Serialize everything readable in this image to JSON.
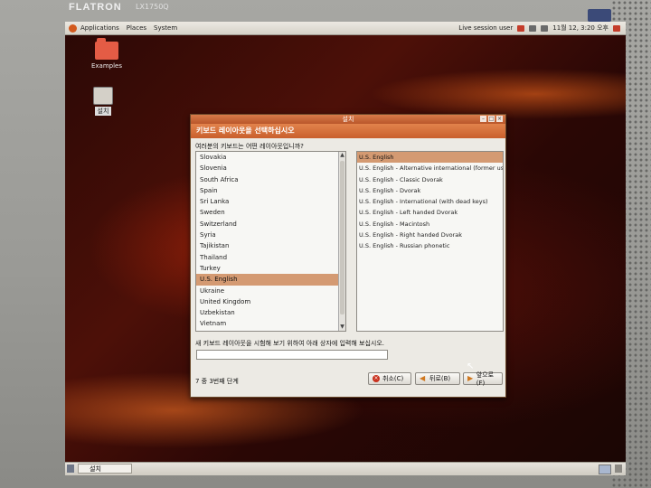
{
  "monitor": {
    "brand": "FLATRON",
    "model": "LX1750Q"
  },
  "top_panel": {
    "menus": [
      "Applications",
      "Places",
      "System"
    ],
    "session": "Live session user",
    "clock": "11월 12, 3:20 오후"
  },
  "desktop": {
    "icons": [
      {
        "label": "Examples"
      },
      {
        "label": "설치"
      }
    ]
  },
  "dialog": {
    "title": "설치",
    "header": "키보드 레이아웃을 선택하십시오",
    "question": "여러분의 키보드는 어떤 레이아웃입니까?",
    "countries": [
      "Slovakia",
      "Slovenia",
      "South Africa",
      "Spain",
      "Sri Lanka",
      "Sweden",
      "Switzerland",
      "Syria",
      "Tajikistan",
      "Thailand",
      "Turkey",
      "U.S. English",
      "Ukraine",
      "United Kingdom",
      "Uzbekistan",
      "Vietnam"
    ],
    "selected_country": "U.S. English",
    "variants": [
      "U.S. English",
      "U.S. English - Alternative international (former us_intl)",
      "U.S. English - Classic Dvorak",
      "U.S. English - Dvorak",
      "U.S. English - International (with dead keys)",
      "U.S. English - Left handed Dvorak",
      "U.S. English - Macintosh",
      "U.S. English - Right handed Dvorak",
      "U.S. English - Russian phonetic"
    ],
    "selected_variant": "U.S. English",
    "test_label": "새 키보드 레이아웃을 시험해 보기 위하여 아래 상자에 입력해 보십시오.",
    "test_value": "",
    "step": "7 중 3번째 단계",
    "buttons": {
      "cancel": "취소(C)",
      "back": "뒤로(B)",
      "forward": "앞으로(F)"
    }
  },
  "bottom_panel": {
    "task": "설치"
  }
}
